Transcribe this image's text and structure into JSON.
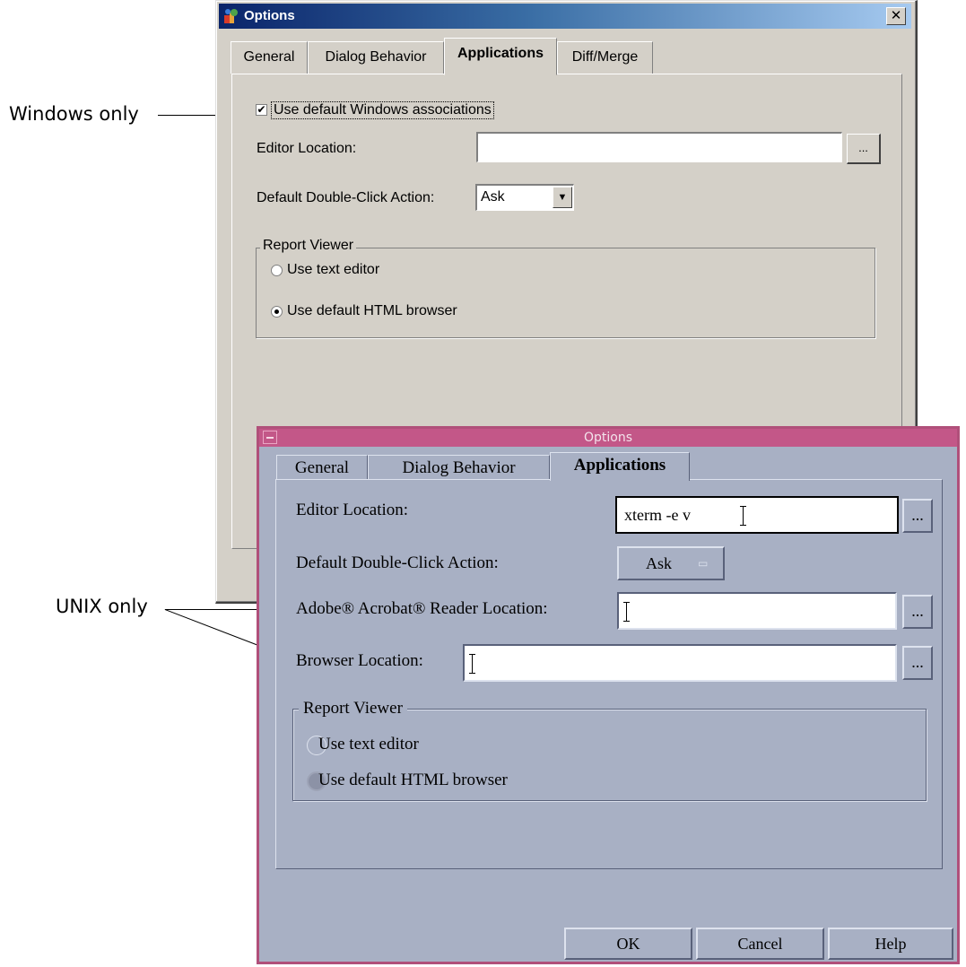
{
  "annotations": {
    "windows_only": "Windows only",
    "unix_only": "UNIX only"
  },
  "windows_dialog": {
    "title": "Options",
    "close_symbol": "✕",
    "tabs": [
      {
        "label": "General"
      },
      {
        "label": "Dialog Behavior"
      },
      {
        "label": "Applications",
        "active": true
      },
      {
        "label": "Diff/Merge"
      }
    ],
    "use_default_assoc_label": "Use default Windows associations",
    "use_default_assoc_checked": true,
    "check_mark": "✔",
    "editor_location_label": "Editor Location:",
    "editor_location_value": "",
    "browse_label": "...",
    "double_click_label": "Default Double-Click Action:",
    "double_click_value": "Ask",
    "dropdown_arrow": "▼",
    "report_viewer": {
      "legend": "Report Viewer",
      "options": [
        {
          "label": "Use text editor",
          "selected": false
        },
        {
          "label": "Use default HTML browser",
          "selected": true
        }
      ]
    }
  },
  "unix_dialog": {
    "title": "Options",
    "tabs": [
      {
        "label": "General"
      },
      {
        "label": "Dialog Behavior"
      },
      {
        "label": "Applications",
        "active": true
      }
    ],
    "editor_location_label": "Editor Location:",
    "editor_location_value": "xterm -e v",
    "browse_label": "...",
    "double_click_label": "Default Double-Click Action:",
    "double_click_value": "Ask",
    "option_menu_indicator": "▭",
    "acrobat_label": "Adobe® Acrobat® Reader Location:",
    "acrobat_value": "",
    "browser_label": "Browser Location:",
    "browser_value": "",
    "report_viewer": {
      "legend": "Report Viewer",
      "options": [
        {
          "label": "Use text editor",
          "selected": false
        },
        {
          "label": "Use default HTML browser",
          "selected": true
        }
      ]
    },
    "buttons": {
      "ok": "OK",
      "cancel": "Cancel",
      "help": "Help"
    }
  },
  "colors": {
    "windows_face": "#d4d0c8",
    "windows_title_start": "#0a246a",
    "windows_title_end": "#a6caf0",
    "unix_face": "#a8b0c4",
    "unix_title": "#c35788"
  }
}
